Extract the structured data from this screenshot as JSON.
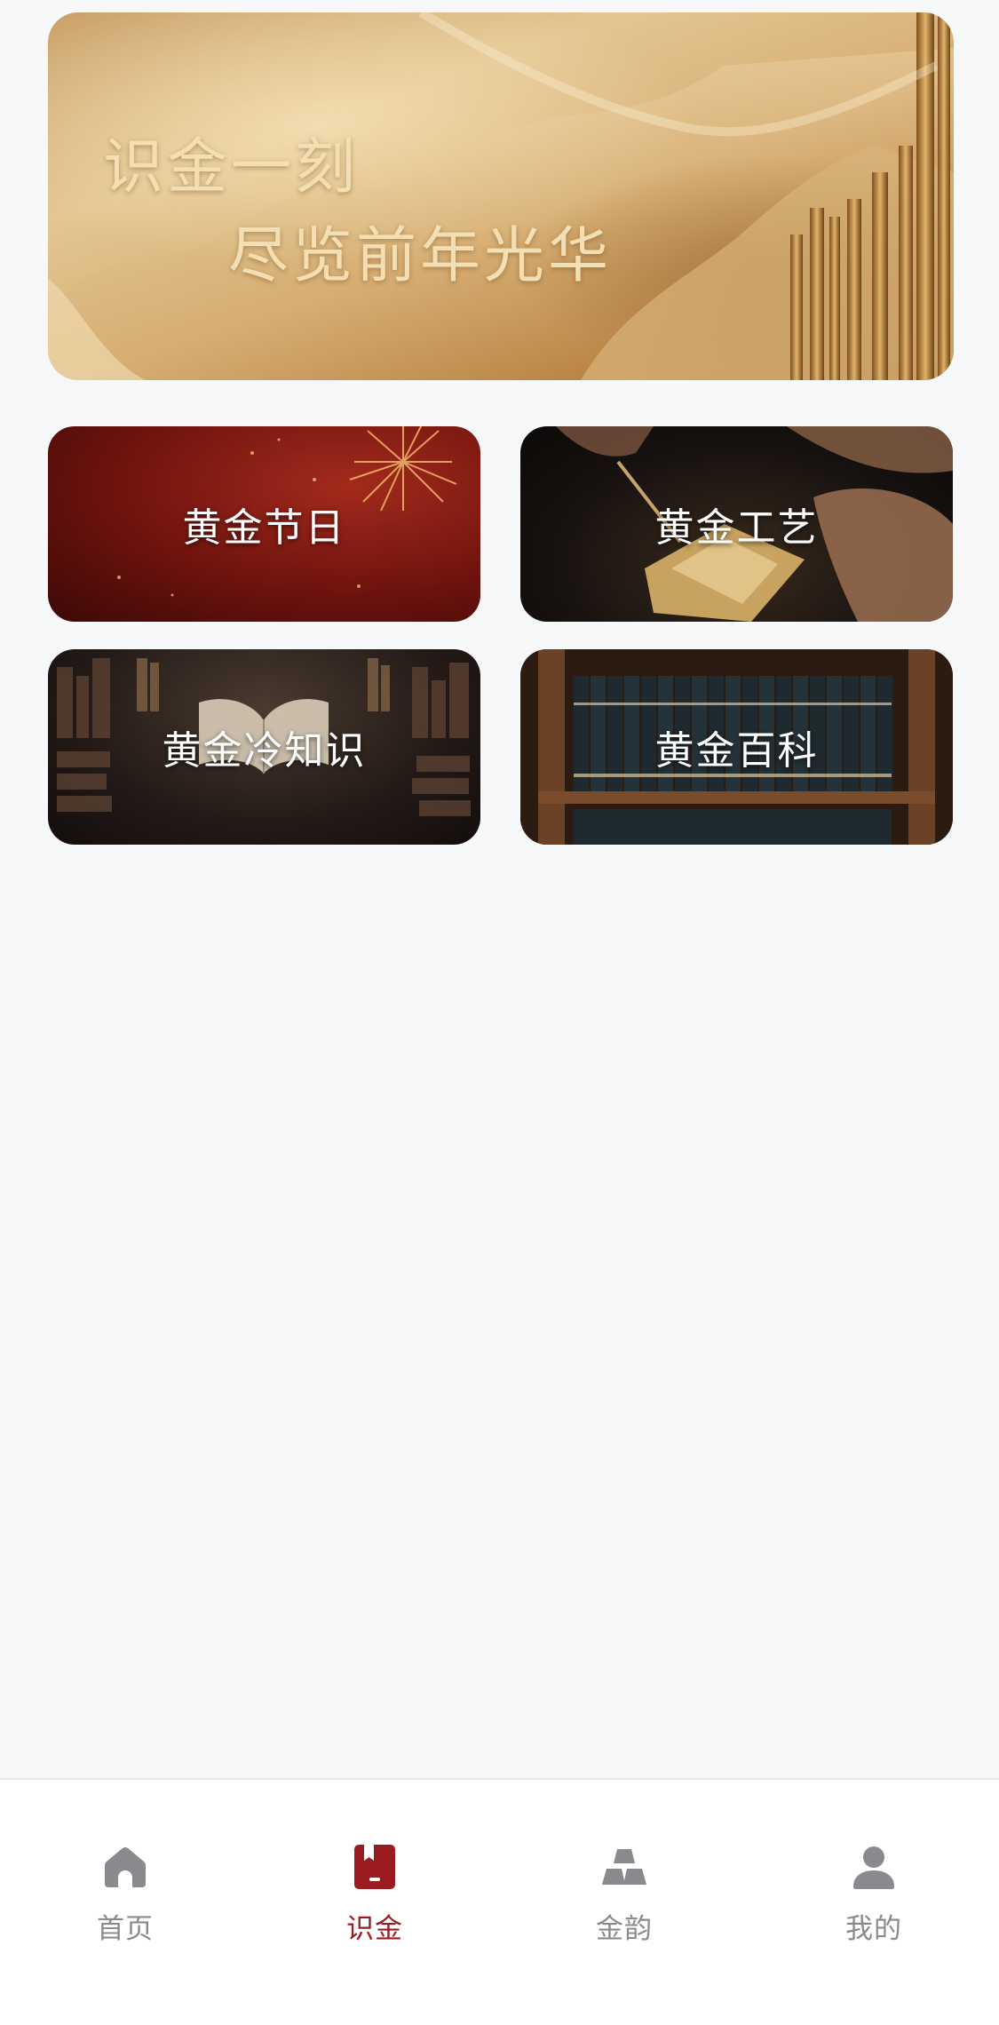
{
  "banner": {
    "line1": "识金一刻",
    "line2": "尽览前年光华"
  },
  "cards": [
    {
      "label": "黄金节日"
    },
    {
      "label": "黄金工艺"
    },
    {
      "label": "黄金冷知识"
    },
    {
      "label": "黄金百科"
    }
  ],
  "tabbar": {
    "active_index": 1,
    "active_color": "#9a1b20",
    "inactive_color": "#8a8a8e",
    "items": [
      {
        "label": "首页",
        "icon": "home-icon"
      },
      {
        "label": "识金",
        "icon": "bookmark-book-icon"
      },
      {
        "label": "金韵",
        "icon": "gold-bars-icon"
      },
      {
        "label": "我的",
        "icon": "user-icon"
      }
    ]
  }
}
